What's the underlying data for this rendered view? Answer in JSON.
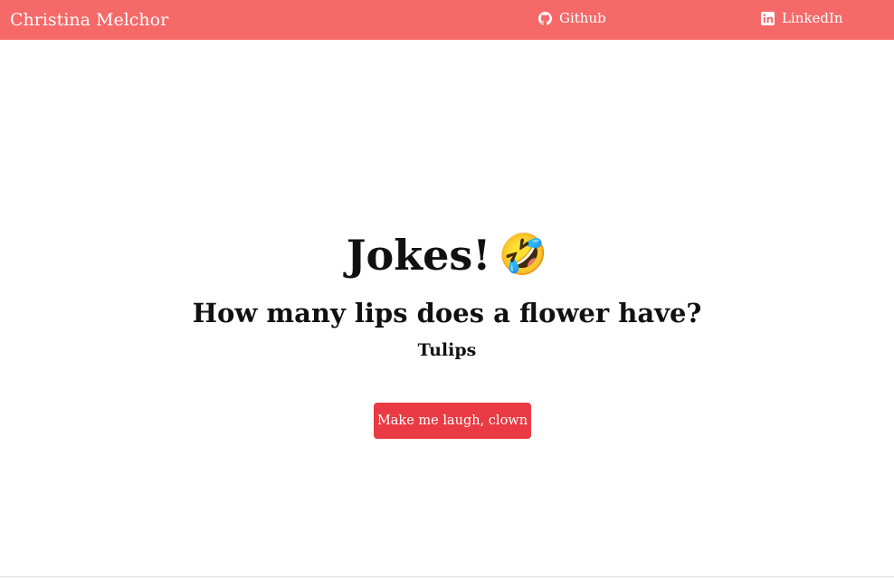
{
  "navbar": {
    "brand": "Christina Melchor",
    "background_color": "#f56969",
    "links": [
      {
        "label": "Github",
        "icon": "github-icon"
      },
      {
        "label": "LinkedIn",
        "icon": "linkedin-icon"
      }
    ]
  },
  "main": {
    "title": "Jokes!",
    "title_emoji": "🤣",
    "question": "How many lips does a flower have?",
    "answer": "Tulips",
    "button_label": "Make me laugh, clown",
    "button_color": "#ea3a43"
  }
}
